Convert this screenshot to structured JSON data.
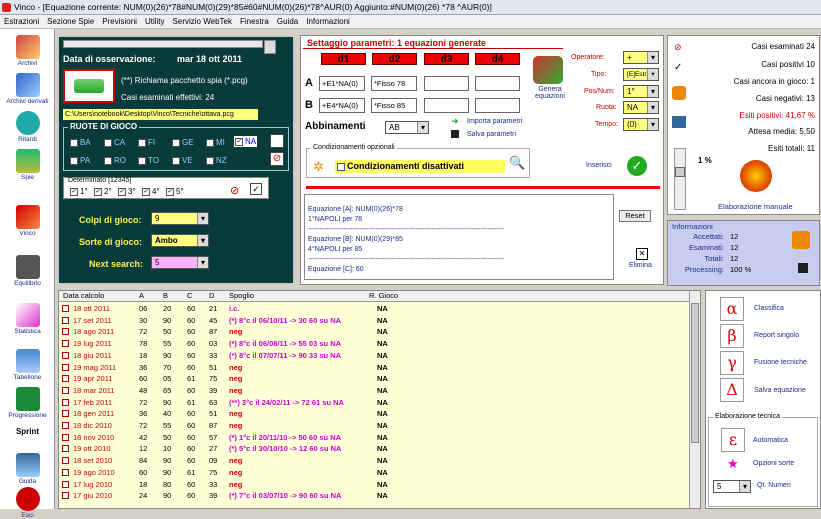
{
  "window": {
    "title": "Vinco - [Equazione corrente: NUM(0)(26)*78#NUM(0)(29)*85#60#NUM(0)(26)*78^AUR(0) Aggiunto:#NUM(0)(26) *78 ^AUR(0)]"
  },
  "menu": [
    "Estrazioni",
    "Sezione Spie",
    "Previsioni",
    "Utility",
    "Servizio WebTek",
    "Finestra",
    "Guida",
    "Informazioni"
  ],
  "sidebar": [
    "Archivi",
    "Archivi derivati",
    "Ritardi",
    "Spie",
    "Vinco",
    "Equilibrio",
    "Statistica",
    "Tabellone",
    "Progressione",
    "Sprint",
    "Guida",
    "Esci"
  ],
  "left": {
    "obs_label": "Data di osservazione:",
    "obs_date": "mar 18 ott 2011",
    "spy_text": "(**) Richiama pacchetto spia (*.pcg)",
    "cases_text": "Casi esaminati effettivi: 24",
    "path": "C:\\Users\\notebook\\Desktop\\Vinco\\Tecniche\\ottava.pcg",
    "ruote_title": "RUOTE DI GIOCO",
    "ruote": [
      "BA",
      "CA",
      "FI",
      "GE",
      "MI",
      "NA",
      "PA",
      "RO",
      "TO",
      "VE",
      "NZ"
    ],
    "det_label": "Determinato [12345]",
    "det": [
      "1°",
      "2°",
      "3°",
      "4°",
      "5°"
    ],
    "colpi_label": "Colpi di gioco:",
    "colpi_val": "9",
    "sorte_label": "Sorte di gioco:",
    "sorte_val": "Ambo",
    "next_label": "Next search:",
    "next_val": "5"
  },
  "settings": {
    "title": "Settaggio parametri: 1 equazioni generate",
    "cols": [
      "d1",
      "d2",
      "d3",
      "d4"
    ],
    "rowA": "A",
    "rowB": "B",
    "a1": "+E1*NA(0)",
    "a2": "*Fisso 78",
    "b1": "+E4*NA(0)",
    "b2": "*Fisso 85",
    "genera": "Genera equazioni",
    "abbinamenti": "Abbinamenti",
    "abb_val": "AB",
    "import": "Importa parametri",
    "save": "Salva parametri",
    "cond_title": "Condizionamenti opzionali",
    "cond_text": "Condizionamenti disattivati",
    "op_label": "Operatore:",
    "op_val": "+",
    "tipo_label": "Tipo:",
    "tipo_val": "[E]Estr.",
    "pos_label": "Pos/Num:",
    "pos_val": "1°",
    "ruota_label": "Ruota:",
    "ruota_val": "NA",
    "tempo_label": "Tempo:",
    "tempo_val": "(0)",
    "inserisci": "Inserisci",
    "reset": "Reset",
    "elimina": "Elimina",
    "eq_lines": [
      "Equazione [A]: NUM(0)(26)*78",
      "1°NAPOLI per 78",
      "------------------------------------------------------------------------------------",
      "Equazione [B]: NUM(0)(29)*85",
      "4°NAPOLI per 85",
      "------------------------------------------------------------------------------------",
      "Equazione [C]: 60"
    ]
  },
  "stats": {
    "esaminati": "Casi esaminati 24",
    "positivi": "Casi positivi 10",
    "ancora": "Casi ancora in gioco: 1",
    "negativi": "Casi negativi: 13",
    "esiti": "Esiti positivi: 41,67 %",
    "attesa": "Attesa media: 5,50",
    "totali": "Esiti totali: 11",
    "pct": "1 %",
    "elab": "Elaborazione manuale"
  },
  "info": {
    "title": "Informazioni",
    "accettati_l": "Accettati:",
    "accettati": "12",
    "esaminati_l": "Esaminati:",
    "esaminati": "12",
    "totali_l": "Totali:",
    "totali": "12",
    "processing_l": "Processing:",
    "processing": "100 %"
  },
  "table": {
    "headers": [
      "Data calcolo",
      "A",
      "B",
      "C",
      "D",
      "Spoglio",
      "R. Gioco"
    ],
    "rows": [
      [
        "18 ott 2011",
        "06",
        "20",
        "60",
        "21",
        "i.c.",
        "NA"
      ],
      [
        "17 set 2011",
        "30",
        "90",
        "60",
        "45",
        "(*) 8°c il 06/10/11 -> 30 60 su NA",
        "NA"
      ],
      [
        "18 ago 2011",
        "72",
        "50",
        "60",
        "87",
        "neg",
        "NA"
      ],
      [
        "19 lug 2011",
        "78",
        "55",
        "60",
        "03",
        "(*) 8°c il 06/08/11 -> 55 03 su NA",
        "NA"
      ],
      [
        "18 giu 2011",
        "18",
        "90",
        "60",
        "33",
        "(*) 8°c il 07/07/11 -> 90 33 su NA",
        "NA"
      ],
      [
        "19 mag 2011",
        "36",
        "70",
        "60",
        "51",
        "neg",
        "NA"
      ],
      [
        "19 apr 2011",
        "60",
        "05",
        "61",
        "75",
        "neg",
        "NA"
      ],
      [
        "18 mar 2011",
        "48",
        "65",
        "60",
        "39",
        "neg",
        "NA"
      ],
      [
        "17 feb 2011",
        "72",
        "90",
        "61",
        "63",
        "(**) 3°c il 24/02/11 -> 72 61 su NA",
        "NA"
      ],
      [
        "18 gen 2011",
        "36",
        "40",
        "60",
        "51",
        "neg",
        "NA"
      ],
      [
        "18 dic 2010",
        "72",
        "55",
        "60",
        "87",
        "neg",
        "NA"
      ],
      [
        "18 nov 2010",
        "42",
        "50",
        "60",
        "57",
        "(*) 1°c il 20/11/10 -> 50 60 su NA",
        "NA"
      ],
      [
        "19 ott 2010",
        "12",
        "10",
        "60",
        "27",
        "(*) 5°c il 30/10/10 -> 12 60 su NA",
        "NA"
      ],
      [
        "18 set 2010",
        "84",
        "90",
        "60",
        "09",
        "neg",
        "NA"
      ],
      [
        "19 ago 2010",
        "60",
        "90",
        "61",
        "75",
        "neg",
        "NA"
      ],
      [
        "17 lug 2010",
        "18",
        "80",
        "60",
        "33",
        "neg",
        "NA"
      ],
      [
        "17 giu 2010",
        "24",
        "90",
        "60",
        "39",
        "(*) 7°c il 03/07/10 -> 90 60 su NA",
        "NA"
      ]
    ]
  },
  "tools": {
    "classifica": "Classifica",
    "report": "Report singolo",
    "fusione": "Fusione tecniche",
    "salva": "Salva equazione",
    "elab_title": "Elaborazione tecnica",
    "auto": "Automatica",
    "opzioni": "Opzioni sorte",
    "qt_val": "5",
    "qt_label": "Qt. Numeri"
  }
}
